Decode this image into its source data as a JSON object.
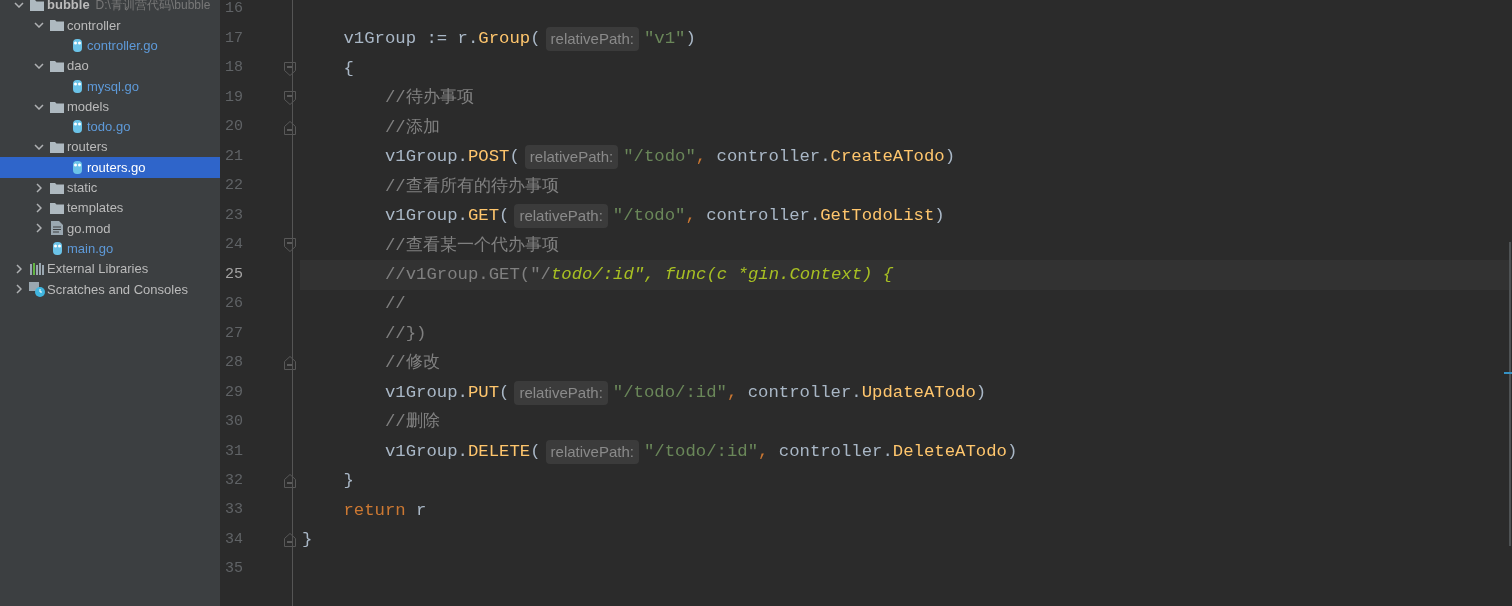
{
  "project_tree": [
    {
      "label": "bubble",
      "kind": "project",
      "hint": "D:\\青训营代码\\bubble",
      "expanded": true,
      "selected": false,
      "children": [
        {
          "label": "controller",
          "kind": "folder",
          "expanded": true,
          "selected": false,
          "children": [
            {
              "label": "controller.go",
              "kind": "go",
              "selected": false
            }
          ]
        },
        {
          "label": "dao",
          "kind": "folder",
          "expanded": true,
          "selected": false,
          "children": [
            {
              "label": "mysql.go",
              "kind": "go",
              "selected": false
            }
          ]
        },
        {
          "label": "models",
          "kind": "folder",
          "expanded": true,
          "selected": false,
          "children": [
            {
              "label": "todo.go",
              "kind": "go",
              "selected": false
            }
          ]
        },
        {
          "label": "routers",
          "kind": "folder",
          "expanded": true,
          "selected": false,
          "children": [
            {
              "label": "routers.go",
              "kind": "go",
              "selected": true
            }
          ]
        },
        {
          "label": "static",
          "kind": "folder",
          "expanded": false,
          "selected": false
        },
        {
          "label": "templates",
          "kind": "folder",
          "expanded": false,
          "selected": false
        },
        {
          "label": "go.mod",
          "kind": "mod",
          "expanded": false,
          "selected": false
        },
        {
          "label": "main.go",
          "kind": "go",
          "selected": false
        }
      ]
    },
    {
      "label": "External Libraries",
      "kind": "libraries",
      "expanded": false,
      "selected": false
    },
    {
      "label": "Scratches and Consoles",
      "kind": "scratches",
      "expanded": false,
      "selected": false
    }
  ],
  "editor": {
    "lines": [
      {
        "number": "16",
        "selected": false
      },
      {
        "number": "17",
        "selected": false,
        "tokens": [
          {
            "text": "    v1Group := r.",
            "kind": "plain"
          },
          {
            "text": "Group",
            "kind": "method"
          },
          {
            "text": "(",
            "kind": "plain"
          },
          {
            "text": "relativePath:",
            "kind": "hint"
          },
          {
            "text": "\"v1\"",
            "kind": "string"
          },
          {
            "text": ")",
            "kind": "plain"
          }
        ]
      },
      {
        "number": "18",
        "selected": false,
        "fold_start": true,
        "tokens": [
          {
            "text": "    {",
            "kind": "plain"
          }
        ]
      },
      {
        "number": "19",
        "selected": false,
        "fold_start": true,
        "tokens": [
          {
            "text": "        //待办事项",
            "kind": "comment"
          }
        ]
      },
      {
        "number": "20",
        "selected": false,
        "fold_end": true,
        "tokens": [
          {
            "text": "        //添加",
            "kind": "comment"
          }
        ]
      },
      {
        "number": "21",
        "selected": false,
        "tokens": [
          {
            "text": "        v1Group.",
            "kind": "plain"
          },
          {
            "text": "POST",
            "kind": "method"
          },
          {
            "text": "(",
            "kind": "plain"
          },
          {
            "text": "relativePath:",
            "kind": "hint"
          },
          {
            "text": "\"/todo\"",
            "kind": "string"
          },
          {
            "text": ", ",
            "kind": "keyword"
          },
          {
            "text": "controller.",
            "kind": "plain"
          },
          {
            "text": "CreateATodo",
            "kind": "method"
          },
          {
            "text": ")",
            "kind": "plain"
          }
        ]
      },
      {
        "number": "22",
        "selected": false,
        "tokens": [
          {
            "text": "        //查看所有的待办事项",
            "kind": "comment"
          }
        ]
      },
      {
        "number": "23",
        "selected": false,
        "tokens": [
          {
            "text": "        v1Group.",
            "kind": "plain"
          },
          {
            "text": "GET",
            "kind": "method"
          },
          {
            "text": "(",
            "kind": "plain"
          },
          {
            "text": "relativePath:",
            "kind": "hint"
          },
          {
            "text": "\"/todo\"",
            "kind": "string"
          },
          {
            "text": ", ",
            "kind": "keyword"
          },
          {
            "text": "controller.",
            "kind": "plain"
          },
          {
            "text": "GetTodoList",
            "kind": "method"
          },
          {
            "text": ")",
            "kind": "plain"
          }
        ]
      },
      {
        "number": "24",
        "selected": false,
        "fold_start": true,
        "tokens": [
          {
            "text": "        //查看某一个代办事项",
            "kind": "comment"
          }
        ]
      },
      {
        "number": "25",
        "selected": true,
        "tokens": [
          {
            "text": "        //v1Group.GET(\"/",
            "kind": "comment"
          },
          {
            "text": "todo/:id\", func(c *gin.Context) {",
            "kind": "todo"
          }
        ]
      },
      {
        "number": "26",
        "selected": false,
        "tokens": [
          {
            "text": "        //",
            "kind": "comment"
          }
        ]
      },
      {
        "number": "27",
        "selected": false,
        "tokens": [
          {
            "text": "        //})",
            "kind": "comment"
          }
        ]
      },
      {
        "number": "28",
        "selected": false,
        "fold_end": true,
        "tokens": [
          {
            "text": "        //修改",
            "kind": "comment"
          }
        ]
      },
      {
        "number": "29",
        "selected": false,
        "tokens": [
          {
            "text": "        v1Group.",
            "kind": "plain"
          },
          {
            "text": "PUT",
            "kind": "method"
          },
          {
            "text": "(",
            "kind": "plain"
          },
          {
            "text": "relativePath:",
            "kind": "hint"
          },
          {
            "text": "\"/todo/:id\"",
            "kind": "string"
          },
          {
            "text": ", ",
            "kind": "keyword"
          },
          {
            "text": "controller.",
            "kind": "plain"
          },
          {
            "text": "UpdateATodo",
            "kind": "method"
          },
          {
            "text": ")",
            "kind": "plain"
          }
        ]
      },
      {
        "number": "30",
        "selected": false,
        "tokens": [
          {
            "text": "        //删除",
            "kind": "comment"
          }
        ]
      },
      {
        "number": "31",
        "selected": false,
        "tokens": [
          {
            "text": "        v1Group.",
            "kind": "plain"
          },
          {
            "text": "DELETE",
            "kind": "method"
          },
          {
            "text": "(",
            "kind": "plain"
          },
          {
            "text": "relativePath:",
            "kind": "hint"
          },
          {
            "text": "\"/todo/:id\"",
            "kind": "string"
          },
          {
            "text": ", ",
            "kind": "keyword"
          },
          {
            "text": "controller.",
            "kind": "plain"
          },
          {
            "text": "DeleteATodo",
            "kind": "method"
          },
          {
            "text": ")",
            "kind": "plain"
          }
        ]
      },
      {
        "number": "32",
        "selected": false,
        "fold_end": true,
        "tokens": [
          {
            "text": "    }",
            "kind": "plain"
          }
        ]
      },
      {
        "number": "33",
        "selected": false,
        "tokens": [
          {
            "text": "    return",
            "kind": "keyword"
          },
          {
            "text": " r",
            "kind": "plain"
          }
        ]
      },
      {
        "number": "34",
        "selected": false,
        "fold_end": true,
        "tokens": [
          {
            "text": "}",
            "kind": "plain"
          }
        ]
      },
      {
        "number": "35",
        "selected": false
      }
    ]
  }
}
